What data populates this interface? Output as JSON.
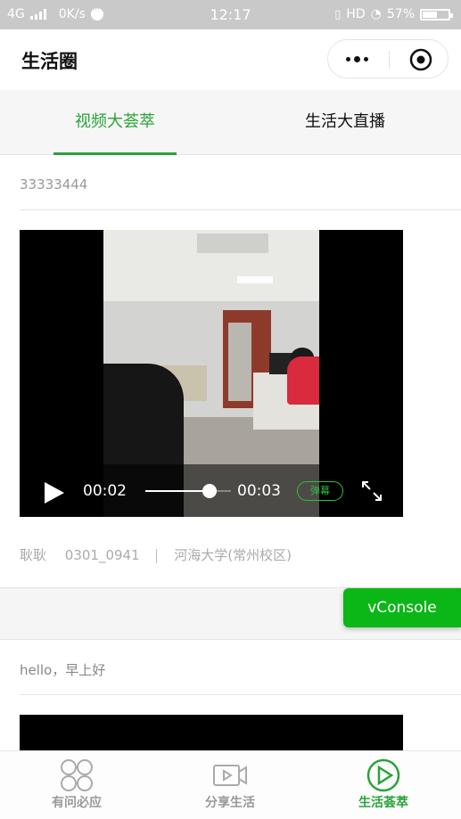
{
  "status_bar": {
    "network": "4G",
    "speed": "0K/s",
    "time": "12:17",
    "hd": "HD",
    "battery_percent": "57%",
    "battery_level": 0.57
  },
  "navbar": {
    "title": "生活圈"
  },
  "tabs": [
    {
      "label": "视频大荟萃",
      "active": true
    },
    {
      "label": "生活大直播",
      "active": false
    }
  ],
  "posts": [
    {
      "title": "33333444",
      "video": {
        "current_time": "00:02",
        "total_time": "00:03",
        "progress": 0.75,
        "danmu_label": "弹幕"
      },
      "author": "耿耿",
      "post_id": "0301_0941",
      "school": "河海大学(常州校区)"
    },
    {
      "title": "hello，早上好"
    }
  ],
  "vconsole": {
    "label": "vConsole"
  },
  "tabbar": [
    {
      "label": "有问必应",
      "icon": "grid-circles-icon",
      "active": false
    },
    {
      "label": "分享生活",
      "icon": "video-camera-icon",
      "active": false
    },
    {
      "label": "生活荟萃",
      "icon": "play-circle-icon",
      "active": true
    }
  ],
  "colors": {
    "accent": "#2aa33a",
    "vconsole": "#0bb716",
    "status_bar_bg": "#c9c9c9"
  }
}
